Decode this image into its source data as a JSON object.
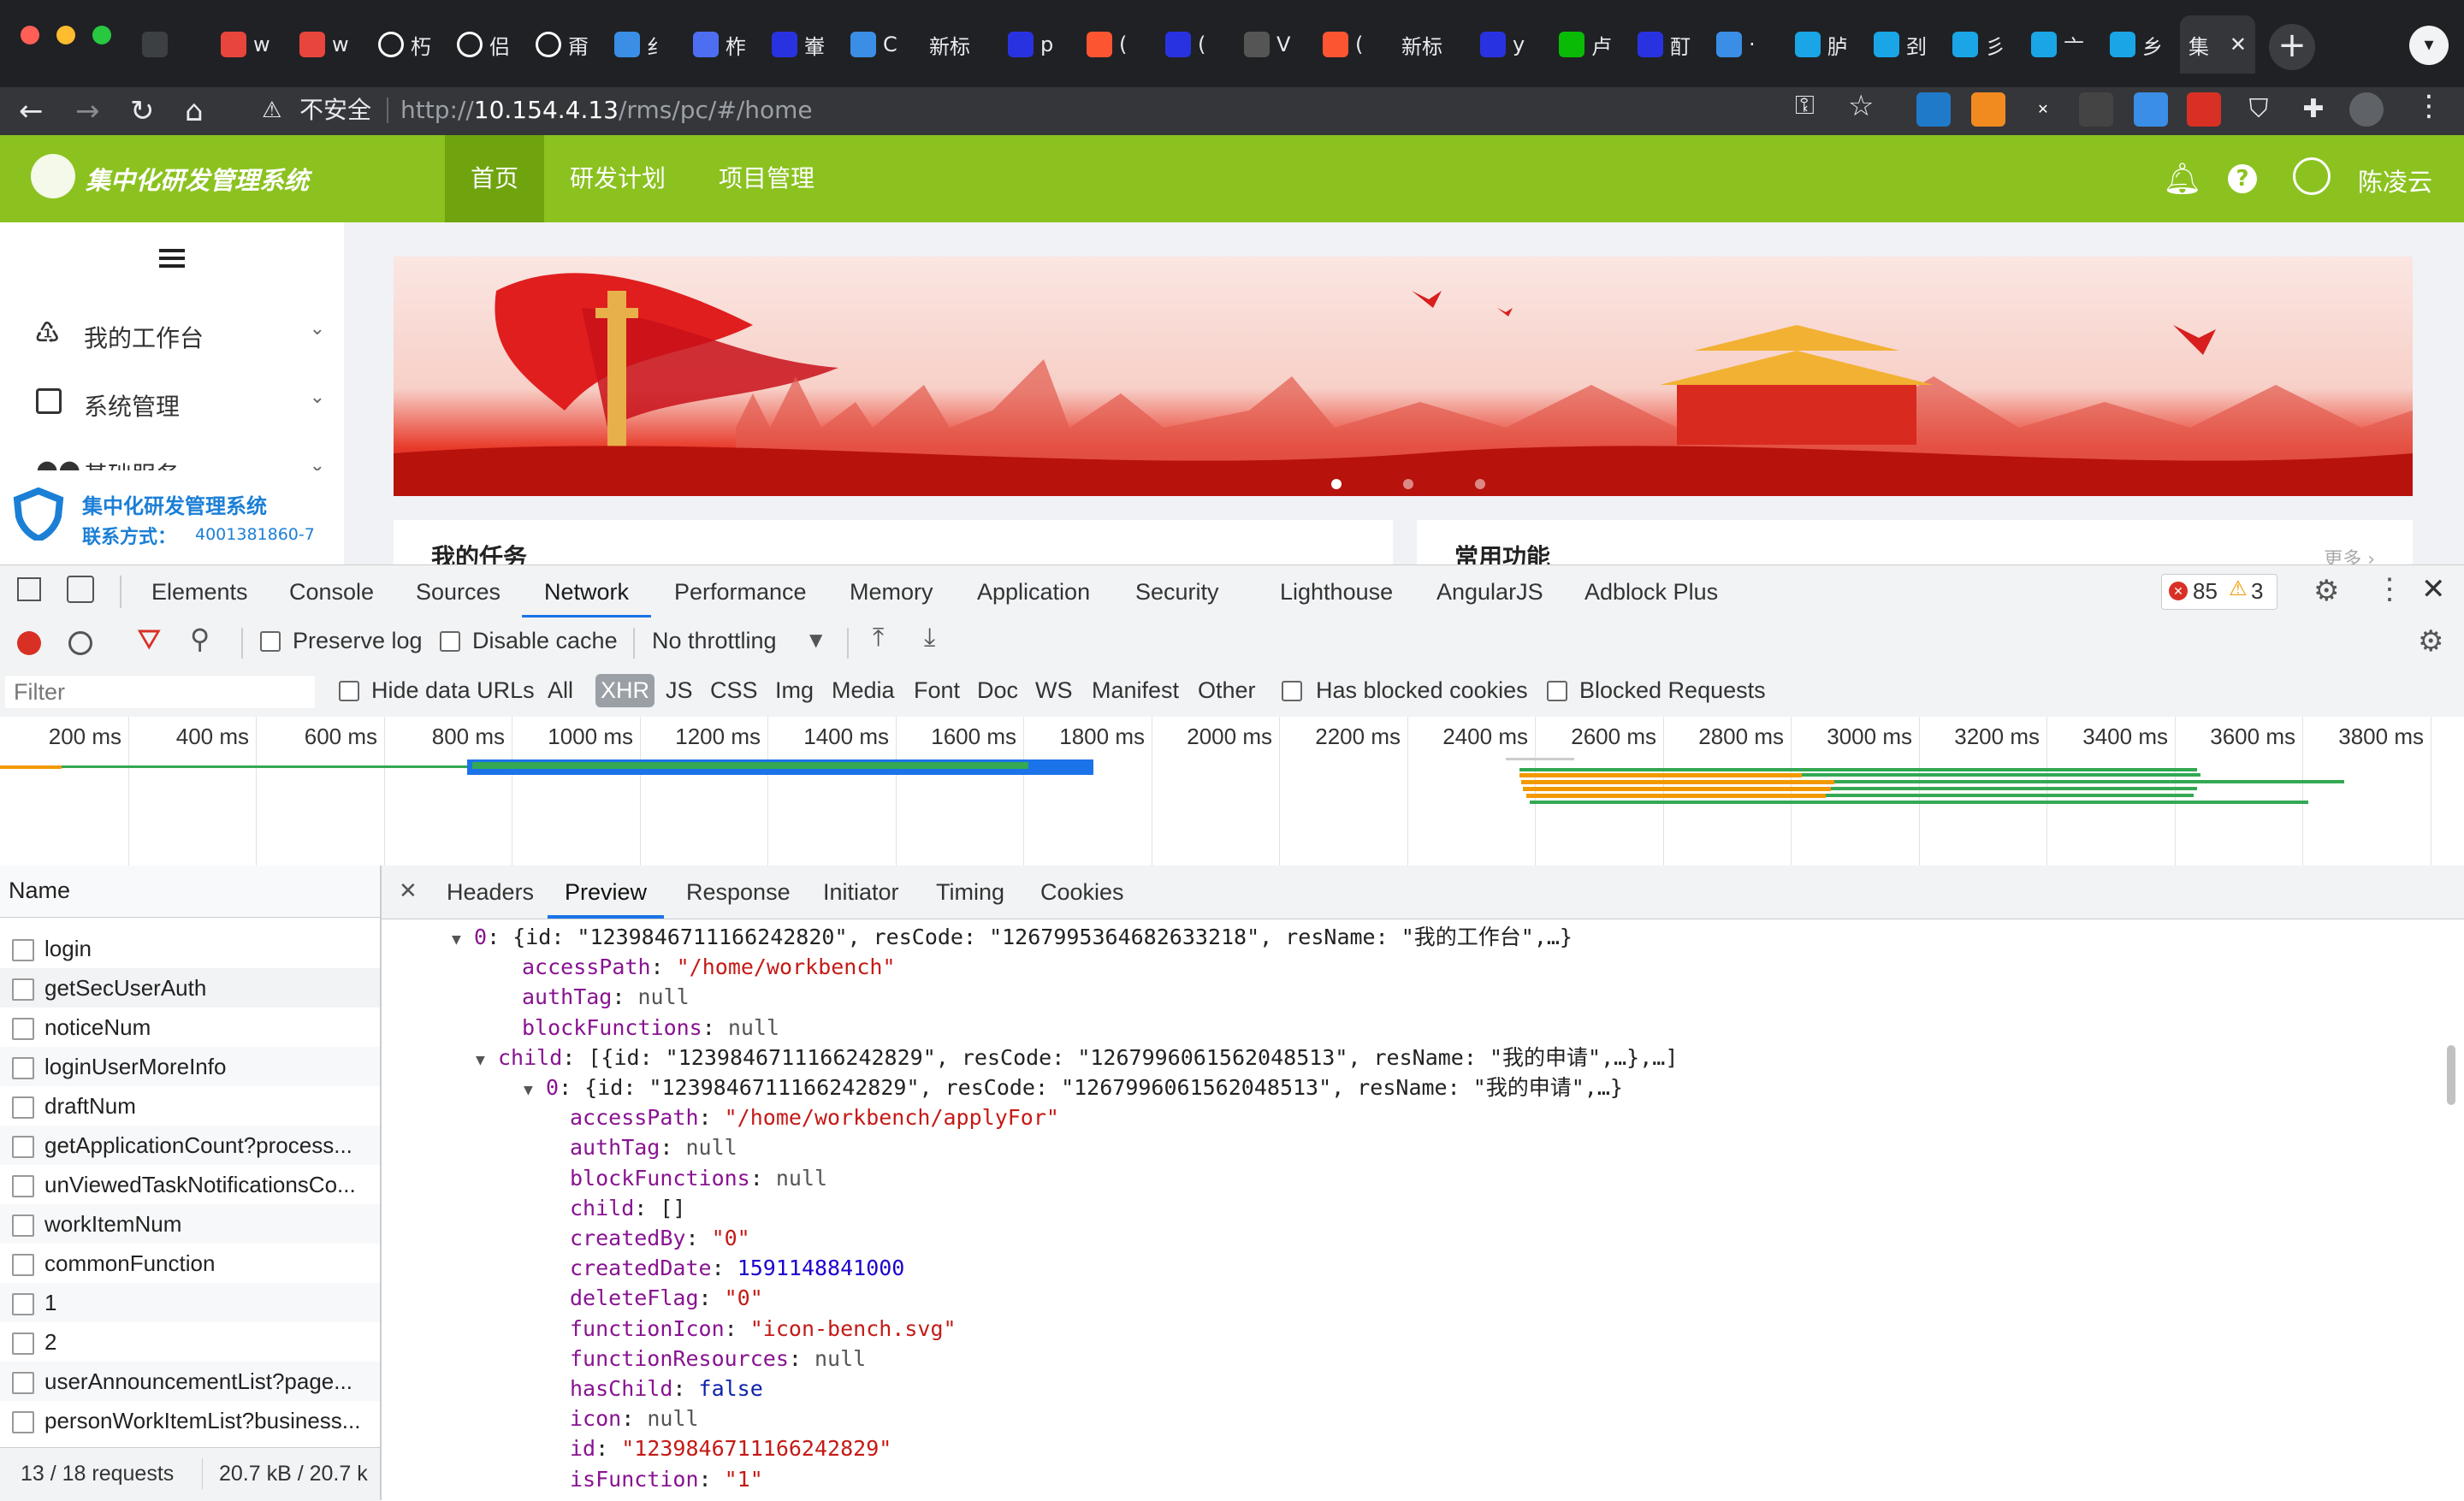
{
  "browser": {
    "tabs": [
      {
        "label": "",
        "icon": "blank-tab-icon",
        "color": "#3c4043"
      },
      {
        "label": "w",
        "icon": "chat-bubble-icon",
        "color": "#e8453c"
      },
      {
        "label": "w",
        "icon": "chat-bubble-icon",
        "color": "#e8453c"
      },
      {
        "label": "朽",
        "icon": "globe-icon",
        "color": "#ffffff"
      },
      {
        "label": "侣",
        "icon": "globe-icon",
        "color": "#ffffff"
      },
      {
        "label": "甭",
        "icon": "globe-icon",
        "color": "#ffffff"
      },
      {
        "label": "纟",
        "icon": "cube-icon",
        "color": "#3a8ee6"
      },
      {
        "label": "柞",
        "icon": "fire-icon",
        "color": "#4e6ef2"
      },
      {
        "label": "輋",
        "icon": "paw-icon",
        "color": "#2932e1"
      },
      {
        "label": "C",
        "icon": "translate-icon",
        "color": "#3a8ee6"
      },
      {
        "label": "新标",
        "icon": "",
        "color": ""
      },
      {
        "label": "p",
        "icon": "paw-icon",
        "color": "#2932e1"
      },
      {
        "label": "(",
        "icon": "c-logo-icon",
        "color": "#fc5531"
      },
      {
        "label": "(",
        "icon": "paw-icon",
        "color": "#2932e1"
      },
      {
        "label": "V",
        "icon": "feather-icon",
        "color": "#555555"
      },
      {
        "label": "(",
        "icon": "c-logo-icon",
        "color": "#fc5531"
      },
      {
        "label": "新标",
        "icon": "",
        "color": ""
      },
      {
        "label": "y",
        "icon": "paw-icon",
        "color": "#2932e1"
      },
      {
        "label": "卢",
        "icon": "wechat-icon",
        "color": "#09bb07"
      },
      {
        "label": "酊",
        "icon": "paw-icon",
        "color": "#2932e1"
      },
      {
        "label": "·",
        "icon": "swirl-icon",
        "color": "#3a8ee6"
      },
      {
        "label": "胪",
        "icon": "play-icon",
        "color": "#19a5e6"
      },
      {
        "label": "刭",
        "icon": "play-icon",
        "color": "#19a5e6"
      },
      {
        "label": "彡",
        "icon": "play-icon",
        "color": "#19a5e6"
      },
      {
        "label": "亠",
        "icon": "play-icon",
        "color": "#19a5e6"
      },
      {
        "label": "乡",
        "icon": "play-icon",
        "color": "#19a5e6"
      },
      {
        "label": "集",
        "icon": "",
        "color": "",
        "active": true
      }
    ],
    "address": {
      "security_label": "不安全",
      "url_prefix": "http://",
      "url_host": "10.154.4.13",
      "url_path": "/rms/pc/#/home"
    }
  },
  "app": {
    "logo_text": "集中化研发管理系统",
    "nav": [
      "首页",
      "研发计划",
      "项目管理"
    ],
    "user_name": "陈凌云",
    "sidebar": {
      "items": [
        "我的工作台",
        "系统管理",
        "基础服务"
      ],
      "footer_title": "集中化研发管理系统",
      "footer_contact_label": "联系方式：",
      "footer_contact_number": "4001381860-7"
    },
    "cards": {
      "tasks_title": "我的任务",
      "functions_title": "常用功能",
      "more_label": "更多 ›"
    }
  },
  "devtools": {
    "tabs": [
      "Elements",
      "Console",
      "Sources",
      "Network",
      "Performance",
      "Memory",
      "Application",
      "Security",
      "Lighthouse",
      "AngularJS",
      "Adblock Plus"
    ],
    "selected_tab": "Network",
    "errors": "85",
    "warnings": "3",
    "toolbar": {
      "preserve_log": "Preserve log",
      "disable_cache": "Disable cache",
      "throttling": "No throttling"
    },
    "filter": {
      "placeholder": "Filter",
      "hide_data_urls": "Hide data URLs",
      "types": [
        "All",
        "XHR",
        "JS",
        "CSS",
        "Img",
        "Media",
        "Font",
        "Doc",
        "WS",
        "Manifest",
        "Other"
      ],
      "selected_type": "XHR",
      "blocked_cookies": "Has blocked cookies",
      "blocked_requests": "Blocked Requests"
    },
    "timeline_ticks": [
      "200 ms",
      "400 ms",
      "600 ms",
      "800 ms",
      "1000 ms",
      "1200 ms",
      "1400 ms",
      "1600 ms",
      "1800 ms",
      "2000 ms",
      "2200 ms",
      "2400 ms",
      "2600 ms",
      "2800 ms",
      "3000 ms",
      "3200 ms",
      "3400 ms",
      "3600 ms",
      "3800 ms"
    ],
    "name_header": "Name",
    "requests": [
      "login",
      "getSecUserAuth",
      "noticeNum",
      "loginUserMoreInfo",
      "draftNum",
      "getApplicationCount?process...",
      "unViewedTaskNotificationsCo...",
      "workItemNum",
      "commonFunction",
      "1",
      "2",
      "userAnnouncementList?page...",
      "personWorkItemList?business..."
    ],
    "selected_request": "getSecUserAuth",
    "status": {
      "requests": "13 / 18 requests",
      "size": "20.7 kB / 20.7 k"
    },
    "detail_tabs": [
      "Headers",
      "Preview",
      "Response",
      "Initiator",
      "Timing",
      "Cookies"
    ],
    "detail_selected": "Preview",
    "preview_lines": [
      {
        "indent": 0,
        "arrow": "▼",
        "key": "0",
        "text": "{id: \"1239846711166242820\", resCode: \"1267995364682633218\", resName: \"我的工作台\",…}",
        "type": "summary"
      },
      {
        "indent": 1,
        "key": "accessPath",
        "text": "\"/home/workbench\"",
        "type": "string"
      },
      {
        "indent": 1,
        "key": "authTag",
        "text": "null",
        "type": "null"
      },
      {
        "indent": 1,
        "key": "blockFunctions",
        "text": "null",
        "type": "null"
      },
      {
        "indent": 0.5,
        "arrow": "▼",
        "key": "child",
        "text": "[{id: \"1239846711166242829\", resCode: \"1267996061562048513\", resName: \"我的申请\",…},…]",
        "type": "summary"
      },
      {
        "indent": 1.5,
        "arrow": "▼",
        "key": "0",
        "text": "{id: \"1239846711166242829\", resCode: \"1267996061562048513\", resName: \"我的申请\",…}",
        "type": "summary"
      },
      {
        "indent": 2,
        "key": "accessPath",
        "text": "\"/home/workbench/applyFor\"",
        "type": "string"
      },
      {
        "indent": 2,
        "key": "authTag",
        "text": "null",
        "type": "null"
      },
      {
        "indent": 2,
        "key": "blockFunctions",
        "text": "null",
        "type": "null"
      },
      {
        "indent": 2,
        "key": "child",
        "text": "[]",
        "type": "plain"
      },
      {
        "indent": 2,
        "key": "createdBy",
        "text": "\"0\"",
        "type": "string"
      },
      {
        "indent": 2,
        "key": "createdDate",
        "text": "1591148841000",
        "type": "number"
      },
      {
        "indent": 2,
        "key": "deleteFlag",
        "text": "\"0\"",
        "type": "string"
      },
      {
        "indent": 2,
        "key": "functionIcon",
        "text": "\"icon-bench.svg\"",
        "type": "string"
      },
      {
        "indent": 2,
        "key": "functionResources",
        "text": "null",
        "type": "null"
      },
      {
        "indent": 2,
        "key": "hasChild",
        "text": "false",
        "type": "bool"
      },
      {
        "indent": 2,
        "key": "icon",
        "text": "null",
        "type": "null"
      },
      {
        "indent": 2,
        "key": "id",
        "text": "\"1239846711166242829\"",
        "type": "string"
      },
      {
        "indent": 2,
        "key": "isFunction",
        "text": "\"1\"",
        "type": "string"
      },
      {
        "indent": 2,
        "key": "icon",
        "text": "null",
        "type": "null"
      }
    ]
  }
}
